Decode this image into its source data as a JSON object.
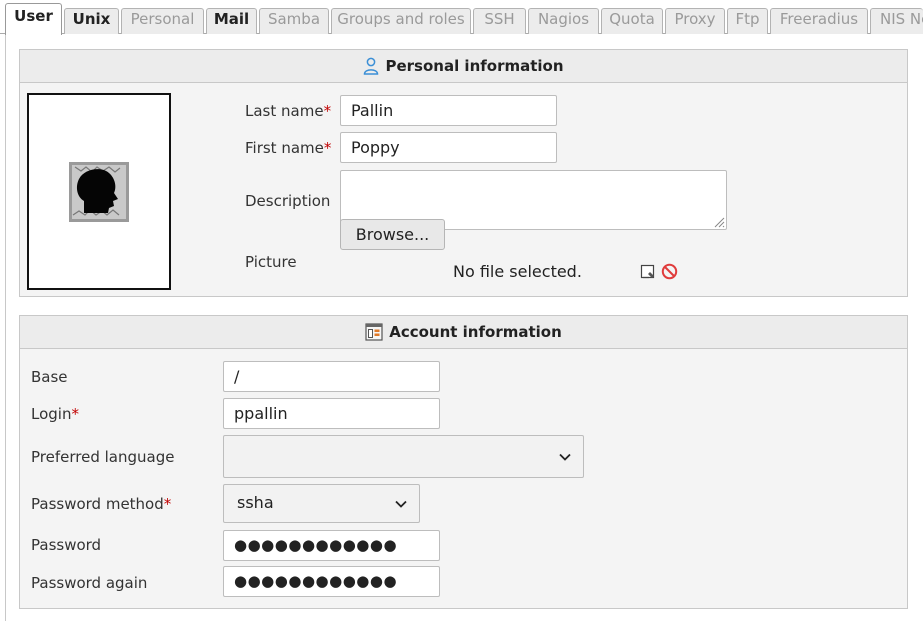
{
  "tabs": [
    {
      "label": "User",
      "state": "active"
    },
    {
      "label": "Unix",
      "state": "enabled"
    },
    {
      "label": "Personal",
      "state": "disabled"
    },
    {
      "label": "Mail",
      "state": "enabled"
    },
    {
      "label": "Samba",
      "state": "disabled"
    },
    {
      "label": "Groups and roles",
      "state": "disabled"
    },
    {
      "label": "SSH",
      "state": "disabled"
    },
    {
      "label": "Nagios",
      "state": "disabled"
    },
    {
      "label": "Quota",
      "state": "disabled"
    },
    {
      "label": "Proxy",
      "state": "disabled"
    },
    {
      "label": "Ftp",
      "state": "disabled"
    },
    {
      "label": "Freeradius",
      "state": "disabled"
    },
    {
      "label": "NIS Ne",
      "state": "disabled"
    }
  ],
  "personal": {
    "title": "Personal information",
    "icon": "user-icon",
    "last_name_label": "Last name",
    "last_name_value": "Pallin",
    "first_name_label": "First name",
    "first_name_value": "Poppy",
    "description_label": "Description",
    "description_value": "",
    "picture_label": "Picture",
    "browse_label": "Browse...",
    "file_status": "No file selected."
  },
  "account": {
    "title": "Account information",
    "icon": "account-icon",
    "base_label": "Base",
    "base_value": "/",
    "login_label": "Login",
    "login_value": "ppallin",
    "language_label": "Preferred language",
    "language_value": "",
    "password_method_label": "Password method",
    "password_method_value": "ssha",
    "password_label": "Password",
    "password_value": "●●●●●●●●●●●●",
    "password_again_label": "Password again",
    "password_again_value": "●●●●●●●●●●●●"
  },
  "required_mark": "*",
  "colors": {
    "required": "#c00000",
    "section_bg": "#f4f4f4",
    "header_bg": "#ececec",
    "user_icon": "#3b8fd6",
    "delete_icon": "#e03c3c"
  }
}
